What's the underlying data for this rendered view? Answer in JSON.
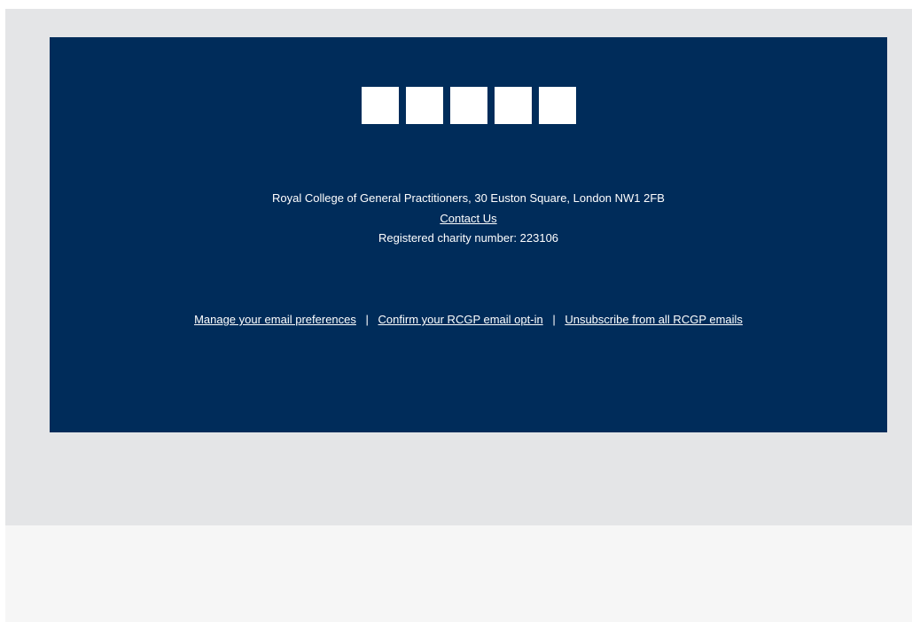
{
  "footer": {
    "social_icons": [
      {
        "icon": "facebook-icon"
      },
      {
        "icon": "twitter-icon"
      },
      {
        "icon": "linkedin-icon"
      },
      {
        "icon": "youtube-icon"
      },
      {
        "icon": "instagram-icon"
      }
    ],
    "address": "Royal College of General Practitioners, 30 Euston Square, London NW1 2FB",
    "contact_label": "Contact Us",
    "charity": "Registered charity number: 223106",
    "links": {
      "manage_prefs": "Manage your email preferences",
      "confirm_optin": "Confirm your RCGP email opt-in",
      "unsubscribe": "Unsubscribe from all RCGP emails",
      "separator": "|"
    }
  },
  "colors": {
    "panel_bg": "#002c5a",
    "outer_bg": "#e4e5e7",
    "bottom_bg": "#f6f6f6",
    "text": "#ffffff"
  }
}
